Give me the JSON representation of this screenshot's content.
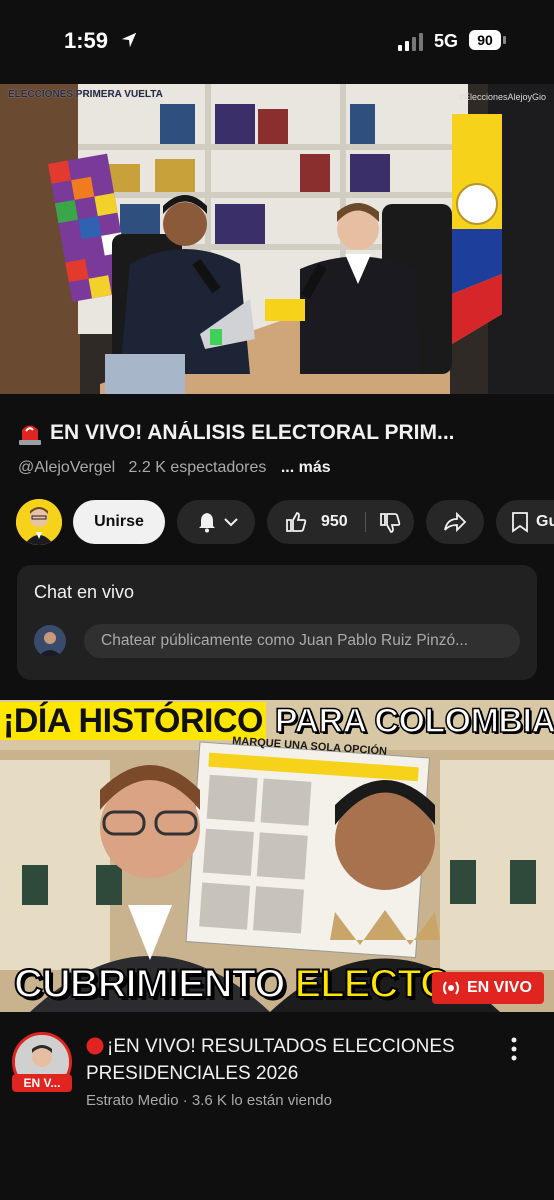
{
  "status_bar": {
    "time": "1:59",
    "network": "5G",
    "battery": "90"
  },
  "video": {
    "watermark_left": "ELECCIONES PRIMERA VUELTA",
    "watermark_right": "#EleccionesAlejoyGio",
    "title": "EN VIVO! ANÁLISIS ELECTORAL PRIM...",
    "channel": "@AlejoVergel",
    "viewers": "2.2 K espectadores",
    "more": "... más"
  },
  "actions": {
    "join": "Unirse",
    "likes": "950",
    "save": "Gu"
  },
  "chat": {
    "title": "Chat en vivo",
    "placeholder": "Chatear públicamente como Juan Pablo Ruiz Pinzó..."
  },
  "thumbnail": {
    "headline_highlight": "¡DÍA HISTÓRICO",
    "headline_rest": " PARA COLOMBIA!",
    "bottom_white": "CUBRIMIENTO ",
    "bottom_yellow": "ELECTO",
    "ballot_header": "MARQUE UNA SOLA OPCIÓN",
    "live_badge": "EN VIVO"
  },
  "next_video": {
    "title": "¡EN VIVO! RESULTADOS ELECCIONES PRESIDENCIALES 2026",
    "channel_live_badge": "EN V...",
    "meta": "Estrato Medio · 3.6 K lo están viendo"
  },
  "colors": {
    "background": "#0f0f0f",
    "live_red": "#e0241f",
    "highlight_yellow": "#ffe600"
  }
}
